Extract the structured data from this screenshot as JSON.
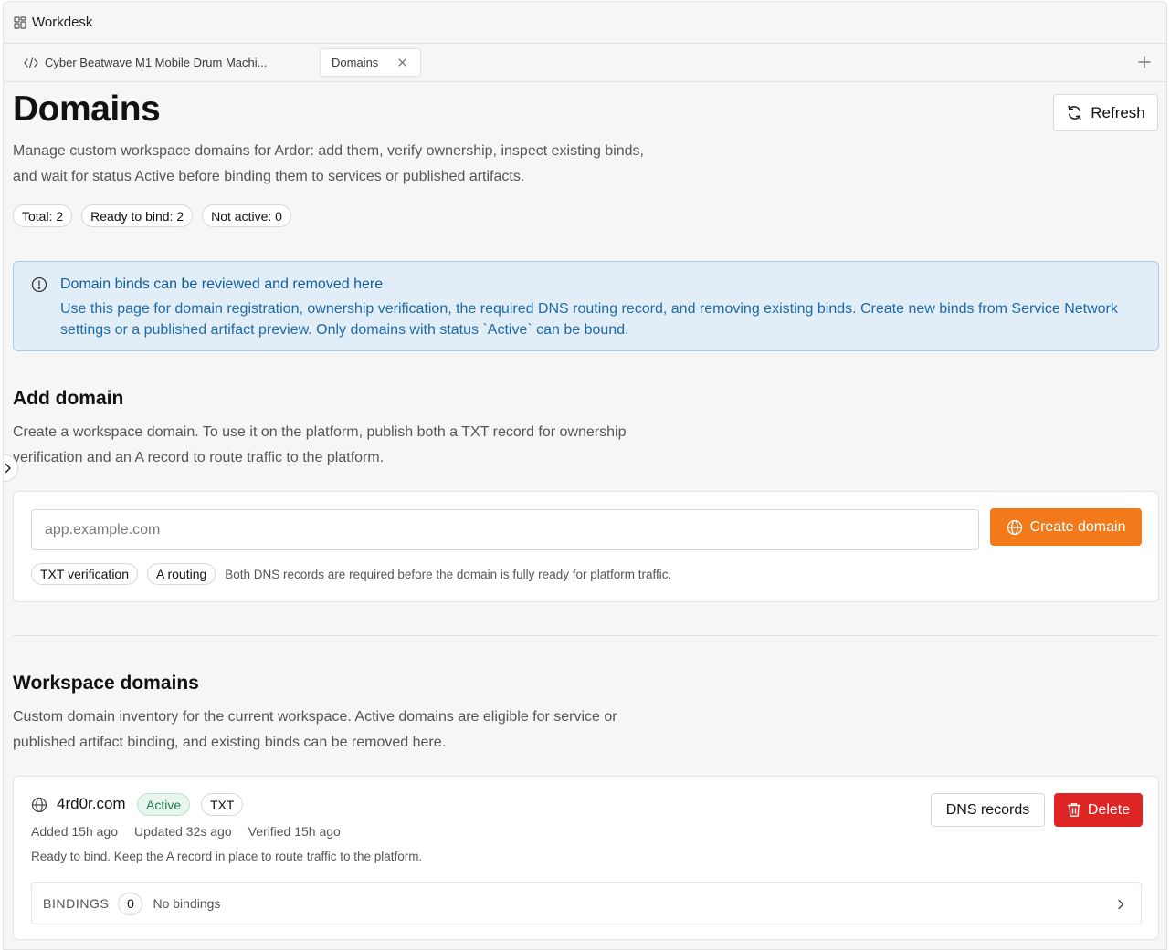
{
  "app": {
    "title": "Workdesk"
  },
  "tabs": [
    {
      "label": "Cyber Beatwave M1 Mobile Drum Machi...",
      "icon": "code-icon"
    },
    {
      "label": "Domains",
      "icon": "close-icon"
    }
  ],
  "page": {
    "title": "Domains",
    "refresh_label": "Refresh",
    "description": "Manage custom workspace domains for Ardor: add them, verify ownership, inspect existing binds, and wait for status Active before binding them to services or published artifacts.",
    "stats": [
      "Total: 2",
      "Ready to bind: 2",
      "Not active: 0"
    ]
  },
  "info": {
    "title": "Domain binds can be reviewed and removed here",
    "body": "Use this page for domain registration, ownership verification, the required DNS routing record, and removing existing binds. Create new binds from Service Network settings or a published artifact preview. Only domains with status `Active` can be bound."
  },
  "add_domain": {
    "title": "Add domain",
    "description": "Create a workspace domain. To use it on the platform, publish both a TXT record for ownership verification and an A record to route traffic to the platform.",
    "input_placeholder": "app.example.com",
    "input_value": "",
    "create_label": "Create domain",
    "tags": [
      "TXT verification",
      "A routing"
    ],
    "note": "Both DNS records are required before the domain is fully ready for platform traffic."
  },
  "workspace_domains": {
    "title": "Workspace domains",
    "description": "Custom domain inventory for the current workspace. Active domains are eligible for service or published artifact binding, and existing binds can be removed here.",
    "items": [
      {
        "name": "4rd0r.com",
        "status": "Active",
        "record": "TXT",
        "added": "Added 15h ago",
        "updated": "Updated 32s ago",
        "verified": "Verified 15h ago",
        "note": "Ready to bind. Keep the A record in place to route traffic to the platform.",
        "dns_label": "DNS records",
        "delete_label": "Delete",
        "bindings_label": "BINDINGS",
        "bindings_count": "0",
        "bindings_empty": "No bindings"
      }
    ]
  },
  "colors": {
    "accent": "#f27a1a",
    "danger": "#df2424",
    "info_bg": "#e1eef8",
    "info_text": "#1e6aa8",
    "active_bg": "#e8f6ee",
    "active_text": "#1e7d4a"
  }
}
